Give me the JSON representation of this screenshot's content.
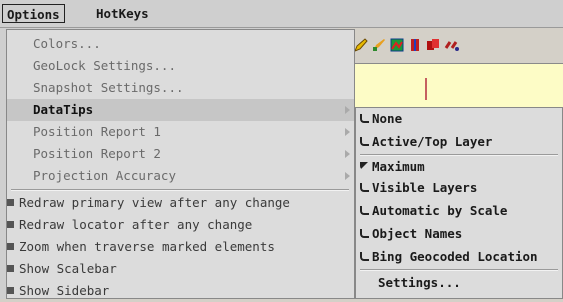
{
  "menubar": {
    "options": "Options",
    "hotkeys": "HotKeys"
  },
  "options_menu": {
    "items": [
      {
        "label": "Colors...",
        "state": "disabled"
      },
      {
        "label": "GeoLock Settings...",
        "state": "disabled"
      },
      {
        "label": "Snapshot Settings...",
        "state": "disabled"
      },
      {
        "label": "DataTips",
        "state": "selected",
        "has_submenu": true
      },
      {
        "label": "Position Report 1",
        "state": "disabled",
        "has_submenu": true
      },
      {
        "label": "Position Report 2",
        "state": "disabled",
        "has_submenu": true
      },
      {
        "label": "Projection Accuracy",
        "state": "disabled",
        "has_submenu": true
      }
    ],
    "toggles": [
      {
        "label": "Redraw primary view after any change",
        "checked": true
      },
      {
        "label": "Redraw locator after any change",
        "checked": true
      },
      {
        "label": "Zoom when traverse marked elements",
        "checked": true
      },
      {
        "label": "Show Scalebar",
        "checked": true
      },
      {
        "label": "Show Sidebar",
        "checked": true
      }
    ]
  },
  "datatips_submenu": {
    "options": [
      {
        "label": "None",
        "selected": false
      },
      {
        "label": "Active/Top Layer",
        "selected": false
      },
      {
        "label": "Maximum",
        "selected": true
      },
      {
        "label": "Visible Layers",
        "selected": false
      },
      {
        "label": "Automatic by Scale",
        "selected": false
      },
      {
        "label": "Object Names",
        "selected": false
      },
      {
        "label": "Bing Geocoded Location",
        "selected": false
      }
    ],
    "settings": "Settings..."
  },
  "toolbar_icons": [
    "pencil-icon",
    "paint-brush-icon",
    "image-layer-icon",
    "vertical-measure-icon",
    "copy-pages-icon",
    "link-icon"
  ],
  "colors": {
    "menu_bg": "#dcdcdc",
    "canvas_bg": "#fdfcc6",
    "selected_bg": "#c6c6c6"
  }
}
